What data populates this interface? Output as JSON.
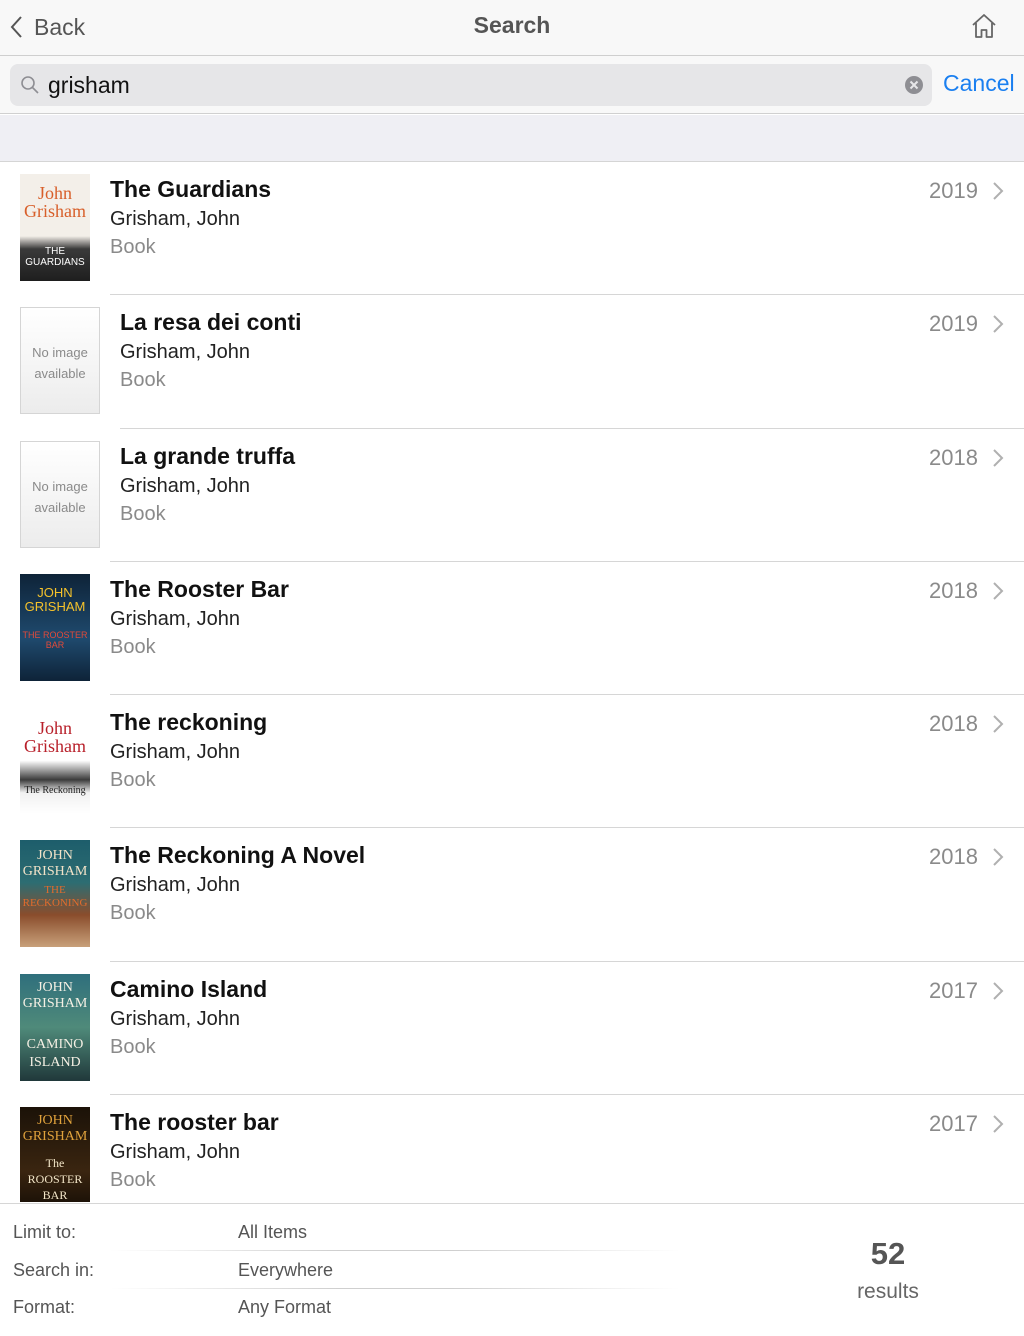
{
  "nav": {
    "back_label": "Back",
    "title": "Search",
    "home_icon": "home-icon"
  },
  "search": {
    "value": "grisham",
    "cancel_label": "Cancel"
  },
  "cover_placeholder": {
    "line1": "No image",
    "line2": "available"
  },
  "results": [
    {
      "title": "The Guardians",
      "author": "Grisham, John",
      "type": "Book",
      "year": "2019",
      "cover": "The Guardians cover",
      "cover_text_a": "John Grisham",
      "cover_text_b": "THE GUARDIANS"
    },
    {
      "title": "La resa dei conti",
      "author": "Grisham, John",
      "type": "Book",
      "year": "2019",
      "cover": "none"
    },
    {
      "title": "La grande truffa",
      "author": "Grisham, John",
      "type": "Book",
      "year": "2018",
      "cover": "none"
    },
    {
      "title": "The Rooster Bar",
      "author": "Grisham, John",
      "type": "Book",
      "year": "2018",
      "cover": "The Rooster Bar cover",
      "cover_text_a": "JOHN GRISHAM",
      "cover_text_b": "THE ROOSTER BAR"
    },
    {
      "title": "The reckoning",
      "author": "Grisham, John",
      "type": "Book",
      "year": "2018",
      "cover": "The Reckoning cover",
      "cover_text_a": "John Grisham",
      "cover_text_b": "The Reckoning"
    },
    {
      "title": "The Reckoning A Novel",
      "author": "Grisham, John",
      "type": "Book",
      "year": "2018",
      "cover": "The Reckoning large print cover",
      "cover_text_a": "JOHN GRISHAM",
      "cover_text_b": "THE RECKONING"
    },
    {
      "title": "Camino Island",
      "author": "Grisham, John",
      "type": "Book",
      "year": "2017",
      "cover": "Camino Island cover",
      "cover_text_a": "JOHN GRISHAM",
      "cover_text_b": "CAMINO ISLAND"
    },
    {
      "title": "The rooster bar",
      "author": "Grisham, John",
      "type": "Book",
      "year": "2017",
      "cover": "The Rooster Bar cover",
      "cover_text_a": "JOHN GRISHAM",
      "cover_text_b": "The ROOSTER BAR"
    }
  ],
  "filters": [
    {
      "label": "Limit to:",
      "value": "All Items"
    },
    {
      "label": "Search in:",
      "value": "Everywhere"
    },
    {
      "label": "Format:",
      "value": "Any Format"
    }
  ],
  "summary": {
    "count": "52",
    "label": "results"
  },
  "colors": {
    "accent": "#1a7ff0",
    "secondary_text": "#8a8a8a"
  }
}
